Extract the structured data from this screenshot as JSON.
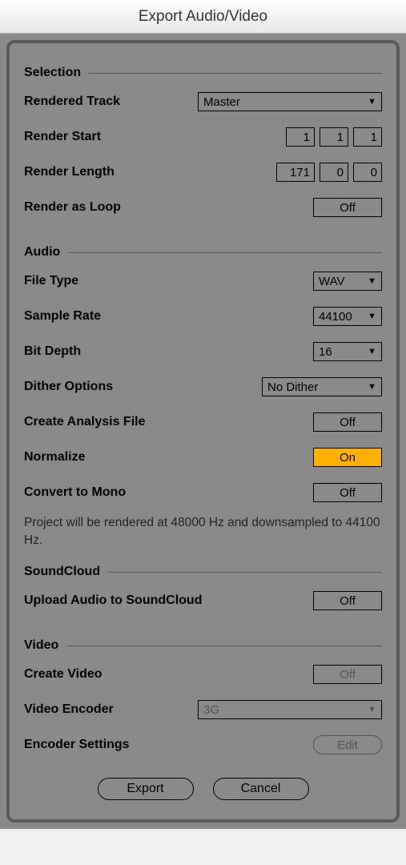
{
  "title": "Export Audio/Video",
  "sections": {
    "selection": {
      "header": "Selection",
      "rendered_track": {
        "label": "Rendered Track",
        "value": "Master"
      },
      "render_start": {
        "label": "Render Start",
        "vals": [
          "1",
          "1",
          "1"
        ]
      },
      "render_length": {
        "label": "Render Length",
        "vals": [
          "171",
          "0",
          "0"
        ]
      },
      "render_loop": {
        "label": "Render as Loop",
        "value": "Off"
      }
    },
    "audio": {
      "header": "Audio",
      "file_type": {
        "label": "File Type",
        "value": "WAV"
      },
      "sample_rate": {
        "label": "Sample Rate",
        "value": "44100"
      },
      "bit_depth": {
        "label": "Bit Depth",
        "value": "16"
      },
      "dither": {
        "label": "Dither Options",
        "value": "No Dither"
      },
      "analysis": {
        "label": "Create Analysis File",
        "value": "Off"
      },
      "normalize": {
        "label": "Normalize",
        "value": "On"
      },
      "mono": {
        "label": "Convert to Mono",
        "value": "Off"
      },
      "info": "Project will be rendered at 48000 Hz and downsampled to 44100 Hz."
    },
    "soundcloud": {
      "header": "SoundCloud",
      "upload": {
        "label": "Upload Audio to SoundCloud",
        "value": "Off"
      }
    },
    "video": {
      "header": "Video",
      "create": {
        "label": "Create Video",
        "value": "Off"
      },
      "encoder": {
        "label": "Video Encoder",
        "value": "3G"
      },
      "settings": {
        "label": "Encoder Settings",
        "value": "Edit"
      }
    }
  },
  "footer": {
    "export": "Export",
    "cancel": "Cancel"
  }
}
